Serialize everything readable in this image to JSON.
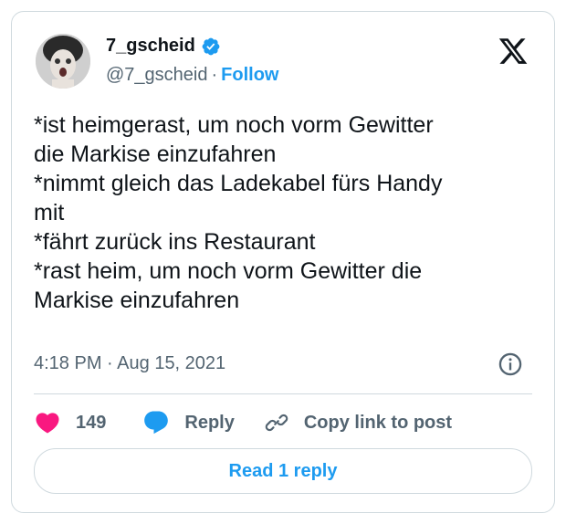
{
  "author": {
    "name": "7_gscheid",
    "handle": "@7_gscheid",
    "separator": "·",
    "follow_label": "Follow",
    "verified_icon": "verified-badge-icon",
    "verified_color": "#1d9bf0"
  },
  "platform_icon": "x-logo-icon",
  "tweet": {
    "lines": [
      "*ist heimgerast, um noch vorm Gewitter",
      "die Markise einzufahren",
      "*nimmt gleich das Ladekabel fürs Handy",
      "mit",
      "*fährt zurück ins Restaurant",
      "*rast heim, um noch vorm Gewitter die",
      "Markise einzufahren"
    ],
    "time": "4:18 PM",
    "separator": "·",
    "date": "Aug 15, 2021"
  },
  "actions": {
    "like_count": "149",
    "reply_label": "Reply",
    "copy_label": "Copy link to post",
    "like_color": "#f91880",
    "reply_color": "#1d9bf0"
  },
  "read_reply_label": "Read 1 reply",
  "colors": {
    "accent": "#1d9bf0",
    "muted": "#536471",
    "text": "#0f1419",
    "border": "#cfd9de"
  }
}
